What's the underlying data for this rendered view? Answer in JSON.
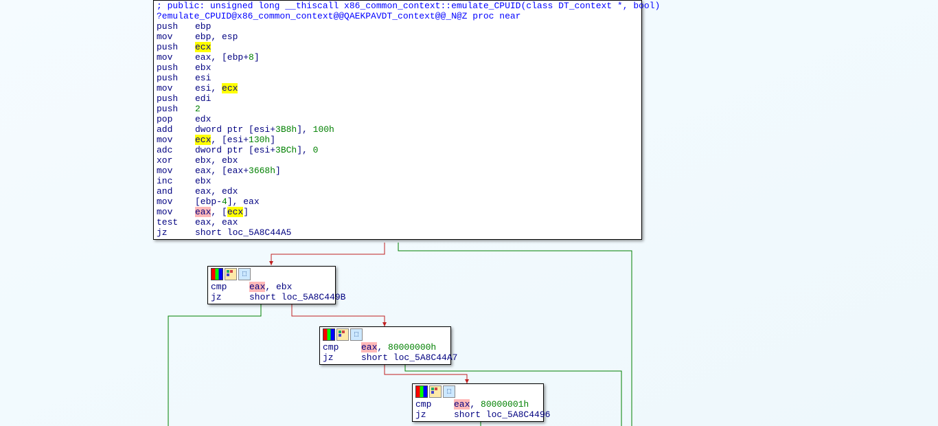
{
  "main_block": {
    "comment": "; public: unsigned long __thiscall x86_common_context::emulate_CPUID(class DT_context *, bool)",
    "proc_label": "?emulate_CPUID@x86_common_context@@QAEKPAVDT_context@@_N@Z proc near",
    "lines": {
      "l01_op": "push",
      "l01_a": "ebp",
      "l02_op": "mov",
      "l02_a": "ebp, esp",
      "l03_op": "push",
      "l03_a": "ecx",
      "l04_op": "mov",
      "l04_a": "eax, [ebp+",
      "l04_n": "8",
      "l04_b": "]",
      "l05_op": "push",
      "l05_a": "ebx",
      "l06_op": "push",
      "l06_a": "esi",
      "l07_op": "mov",
      "l07_a": "esi, ",
      "l07_b": "ecx",
      "l08_op": "push",
      "l08_a": "edi",
      "l09_op": "push",
      "l09_a": "2",
      "l10_op": "pop",
      "l10_a": "edx",
      "l11_op": "add",
      "l11_a": "dword ptr [esi+",
      "l11_n1": "3B8h",
      "l11_b": "], ",
      "l11_n2": "100h",
      "l12_op": "mov",
      "l12_a": "ecx",
      "l12_b": ", [esi+",
      "l12_n": "130h",
      "l12_c": "]",
      "l13_op": "adc",
      "l13_a": "dword ptr [esi+",
      "l13_n1": "3BCh",
      "l13_b": "], ",
      "l13_n2": "0",
      "l14_op": "xor",
      "l14_a": "ebx, ebx",
      "l15_op": "mov",
      "l15_a": "eax, [eax+",
      "l15_n": "3668h",
      "l15_b": "]",
      "l16_op": "inc",
      "l16_a": "ebx",
      "l17_op": "and",
      "l17_a": "eax, edx",
      "l18_op": "mov",
      "l18_a": "[ebp-",
      "l18_n": "4",
      "l18_b": "], eax",
      "l19_op": "mov",
      "l19_a": "eax",
      "l19_b": ", [",
      "l19_c": "ecx",
      "l19_d": "]",
      "l20_op": "test",
      "l20_a": "eax, eax",
      "l21_op": "jz",
      "l21_a": "short loc_5A8C44A5"
    }
  },
  "block2": {
    "l1_op": "cmp",
    "l1_a": "eax",
    "l1_b": ", ebx",
    "l2_op": "jz",
    "l2_a": "short loc_5A8C449B"
  },
  "block3": {
    "l1_op": "cmp",
    "l1_a": "eax",
    "l1_b": ", ",
    "l1_n": "80000000h",
    "l2_op": "jz",
    "l2_a": "short loc_5A8C44A7"
  },
  "block4": {
    "l1_op": "cmp",
    "l1_a": "eax",
    "l1_b": ", ",
    "l1_n": "80000001h",
    "l2_op": "jz",
    "l2_a": "short loc_5A8C4496"
  }
}
